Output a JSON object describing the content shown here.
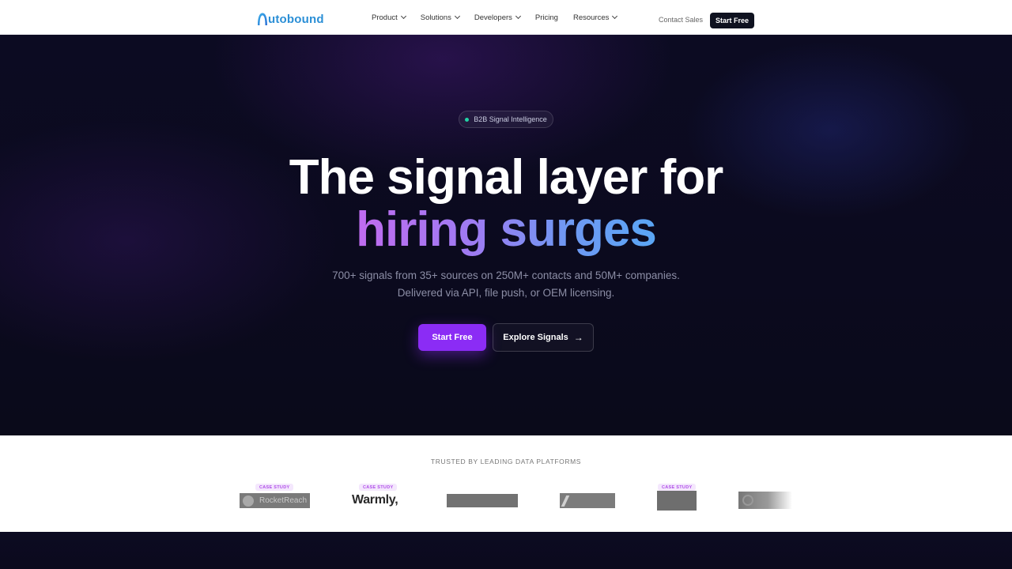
{
  "nav": {
    "logo_text": "utobound",
    "links": [
      {
        "label": "Product",
        "dropdown": true
      },
      {
        "label": "Solutions",
        "dropdown": true
      },
      {
        "label": "Developers",
        "dropdown": true
      },
      {
        "label": "Pricing",
        "dropdown": false
      },
      {
        "label": "Resources",
        "dropdown": true
      }
    ],
    "contact_label": "Contact Sales",
    "start_label": "Start Free"
  },
  "hero": {
    "badge": "B2B Signal Intelligence",
    "headline_line1": "The signal layer for",
    "headline_line2": "hiring surges",
    "subtitle_line1": "700+ signals from 35+ sources on 250M+ contacts and 50M+ companies.",
    "subtitle_line2": "Delivered via API, file push, or OEM licensing.",
    "primary_cta": "Start Free",
    "secondary_cta": "Explore Signals"
  },
  "trusted": {
    "title": "TRUSTED BY LEADING DATA PLATFORMS",
    "case_study_label": "CASE STUDY",
    "logos": [
      {
        "name": "RocketReach",
        "case_study": true
      },
      {
        "name": "Warmly,",
        "case_study": true
      },
      {
        "name": "",
        "case_study": false
      },
      {
        "name": "",
        "case_study": false
      },
      {
        "name": "",
        "case_study": true
      },
      {
        "name": "",
        "case_study": false
      }
    ]
  },
  "colors": {
    "brand_blue": "#2b8fd6",
    "primary_purple": "#8b2cf5",
    "hero_bg": "#0b0a1e",
    "badge_dot": "#22d3a6"
  }
}
